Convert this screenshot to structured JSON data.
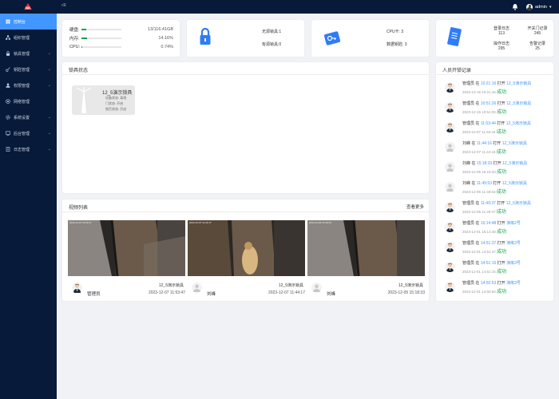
{
  "header": {
    "logo_text": "NK",
    "collapse_label": "‹≡",
    "user_name": "admin"
  },
  "sidebar": {
    "items": [
      {
        "label": "控制台",
        "icon": "dashboard-icon",
        "active": true,
        "has_children": false
      },
      {
        "label": "组织管理",
        "icon": "org-icon",
        "active": false,
        "has_children": false
      },
      {
        "label": "锁具管理",
        "icon": "lock-icon",
        "active": false,
        "has_children": true
      },
      {
        "label": "钥匙管理",
        "icon": "key-icon",
        "active": false,
        "has_children": true
      },
      {
        "label": "权限管理",
        "icon": "user-permission-icon",
        "active": false,
        "has_children": true
      },
      {
        "label": "网络管理",
        "icon": "network-icon",
        "active": false,
        "has_children": false
      },
      {
        "label": "系统设置",
        "icon": "settings-icon",
        "active": false,
        "has_children": true
      },
      {
        "label": "后台管理",
        "icon": "backend-icon",
        "active": false,
        "has_children": true
      },
      {
        "label": "日志管理",
        "icon": "log-icon",
        "active": false,
        "has_children": true
      }
    ]
  },
  "resources": {
    "disk": {
      "label": "硬盘:",
      "value": "13/116.41GB",
      "percent": 11
    },
    "memory": {
      "label": "内存:",
      "value": "14.16%",
      "percent": 14.16
    },
    "cpu": {
      "label": "CPU:",
      "value": "0.74%",
      "percent": 0.74
    }
  },
  "lock_stats": {
    "no_power": "无源锁具:1",
    "powered": "有源锁具:0"
  },
  "key_stats": {
    "cpu_cards": "CPU卡:  3",
    "digital_keys": "数据钥匙: 3"
  },
  "record_stats": {
    "login_label": "登录日志",
    "login_value": "113",
    "open_label": "开关门记录",
    "open_value": "245",
    "op_label": "操作日志",
    "op_value": "295",
    "alarm_label": "告警记录",
    "alarm_value": "25"
  },
  "lock_status": {
    "title": "锁具状态",
    "lock_name": "12_5演示锁具",
    "device_status": "设备状态: 离线",
    "door_status": "门状态: 开启",
    "lock_tongue": "锁舌状态: 开启"
  },
  "video_list": {
    "title": "视频列表",
    "more_label": "查看更多",
    "videos": [
      {
        "lock": "12_5演示锁具",
        "user": "管理员",
        "time": "2023-12-07 11:53:47",
        "overlay": "2023-12-07 11:53:47",
        "avatar": "suit"
      },
      {
        "lock": "12_5演示锁具",
        "user": "刘峰",
        "time": "2023-12-07 11:44:17",
        "overlay": "2023-12-07 11:44:17",
        "avatar": "default"
      },
      {
        "lock": "12_5演示锁具",
        "user": "刘峰",
        "time": "2023-12-05 15:18:33",
        "overlay": "2023-12-05 15:18:33",
        "avatar": "default"
      }
    ]
  },
  "open_records": {
    "title": "人员开锁记录",
    "at_label": "在",
    "open_label": "打开",
    "items": [
      {
        "user": "管理员",
        "time": "10:21:16",
        "lock": "12_5演示锁具",
        "date": "2023-12-15 10:21:16",
        "status": "成功",
        "avatar": "suit"
      },
      {
        "user": "管理员",
        "time": "10:51:26",
        "lock": "12_5演示锁具",
        "date": "2023-12-15 10:51:26",
        "status": "成功",
        "avatar": "suit"
      },
      {
        "user": "管理员",
        "time": "11:53:44",
        "lock": "12_5演示锁具",
        "date": "2023-12-07 11:53:44",
        "status": "成功",
        "avatar": "suit"
      },
      {
        "user": "刘峰",
        "time": "11:44:16",
        "lock": "12_5演示锁具",
        "date": "2023-12-07 11:44:16",
        "status": "成功",
        "avatar": "default"
      },
      {
        "user": "刘峰",
        "time": "15:18:33",
        "lock": "12_5演示锁具",
        "date": "2023-12-05 15:18:33",
        "status": "成功",
        "avatar": "default"
      },
      {
        "user": "刘峰",
        "time": "11:49:53",
        "lock": "12_5演示锁具",
        "date": "2023-12-05 11:49:53",
        "status": "成功",
        "avatar": "default"
      },
      {
        "user": "管理员",
        "time": "11:49:37",
        "lock": "12_5演示锁具",
        "date": "2023-12-05 11:49:37",
        "status": "成功",
        "avatar": "suit"
      },
      {
        "user": "管理员",
        "time": "15:14:48",
        "lock": "演练2号",
        "date": "2023-12-01 15:14:48",
        "status": "成功",
        "avatar": "suit"
      },
      {
        "user": "管理员",
        "time": "14:51:37",
        "lock": "演练3号",
        "date": "2023-12-01 14:51:37",
        "status": "成功",
        "avatar": "suit"
      },
      {
        "user": "管理员",
        "time": "14:51:15",
        "lock": "演练3号",
        "date": "2023-12-01 14:51:15",
        "status": "成功",
        "avatar": "suit"
      },
      {
        "user": "管理员",
        "time": "14:50:53",
        "lock": "演练3号",
        "date": "2023-12-01 14:50:53",
        "status": "成功",
        "avatar": "suit"
      }
    ]
  },
  "colors": {
    "sidebar_bg": "#081a3a",
    "active": "#4196ff",
    "success": "#17a34a",
    "progress": "#17a34a"
  }
}
